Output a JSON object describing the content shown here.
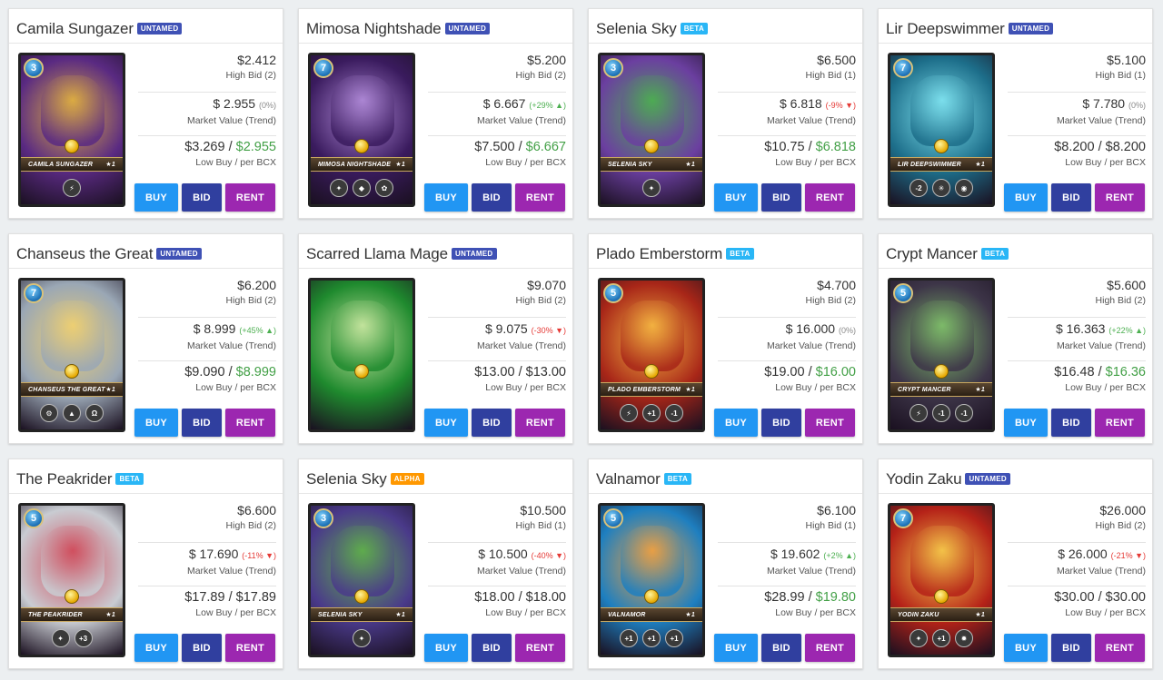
{
  "cards": [
    {
      "name": "Camila Sungazer",
      "edition": "UNTAMED",
      "edition_class": "untamed",
      "mana": "3",
      "banner": "Camila Sungazer",
      "level": "★1",
      "high_bid": "$2.412",
      "high_bid_label": "High Bid (2)",
      "market_value": "$ 2.955",
      "trend": "(0%)",
      "trend_dir": "flat",
      "market_label": "Market Value (Trend)",
      "low_buy": "$3.269",
      "per_bcx": "$2.955",
      "per_bcx_green": true,
      "low_label": "Low Buy / per BCX",
      "art_bg": "#5a2a82",
      "art_accent": "#e0b040",
      "abilities": [
        "⚡"
      ]
    },
    {
      "name": "Mimosa Nightshade",
      "edition": "UNTAMED",
      "edition_class": "untamed",
      "mana": "7",
      "banner": "Mimosa Nightshade",
      "level": "★1",
      "high_bid": "$5.200",
      "high_bid_label": "High Bid (2)",
      "market_value": "$ 6.667",
      "trend": "(+29% ▲)",
      "trend_dir": "up",
      "market_label": "Market Value (Trend)",
      "low_buy": "$7.500",
      "per_bcx": "$6.667",
      "per_bcx_green": true,
      "low_label": "Low Buy / per BCX",
      "art_bg": "#3a1b5e",
      "art_accent": "#b08ad8",
      "abilities": [
        "✦",
        "◆",
        "✿"
      ]
    },
    {
      "name": "Selenia Sky",
      "edition": "BETA",
      "edition_class": "beta",
      "mana": "3",
      "banner": "Selenia Sky",
      "level": "★1",
      "high_bid": "$6.500",
      "high_bid_label": "High Bid (1)",
      "market_value": "$ 6.818",
      "trend": "(-9% ▼)",
      "trend_dir": "down",
      "market_label": "Market Value (Trend)",
      "low_buy": "$10.75",
      "per_bcx": "$6.818",
      "per_bcx_green": true,
      "low_label": "Low Buy / per BCX",
      "art_bg": "#6b3fa0",
      "art_accent": "#4caf50",
      "abilities": [
        "✦"
      ]
    },
    {
      "name": "Lir Deepswimmer",
      "edition": "UNTAMED",
      "edition_class": "untamed",
      "mana": "7",
      "banner": "Lir Deepswimmer",
      "level": "★1",
      "high_bid": "$5.100",
      "high_bid_label": "High Bid (1)",
      "market_value": "$ 7.780",
      "trend": "(0%)",
      "trend_dir": "flat",
      "market_label": "Market Value (Trend)",
      "low_buy": "$8.200",
      "per_bcx": "$8.200",
      "per_bcx_green": false,
      "low_label": "Low Buy / per BCX",
      "art_bg": "#1d6e8a",
      "art_accent": "#7fe3f0",
      "abilities": [
        "-2",
        "✳",
        "◉"
      ]
    },
    {
      "name": "Chanseus the Great",
      "edition": "UNTAMED",
      "edition_class": "untamed",
      "mana": "7",
      "banner": "Chanseus the Great",
      "level": "★1",
      "high_bid": "$6.200",
      "high_bid_label": "High Bid (2)",
      "market_value": "$ 8.999",
      "trend": "(+45% ▲)",
      "trend_dir": "up",
      "market_label": "Market Value (Trend)",
      "low_buy": "$9.090",
      "per_bcx": "$8.999",
      "per_bcx_green": true,
      "low_label": "Low Buy / per BCX",
      "art_bg": "#9aa7b5",
      "art_accent": "#f0d070",
      "abilities": [
        "⚙",
        "▲",
        "Ω"
      ]
    },
    {
      "name": "Scarred Llama Mage",
      "edition": "UNTAMED",
      "edition_class": "untamed",
      "mana": "",
      "banner": "",
      "level": "",
      "high_bid": "$9.070",
      "high_bid_label": "High Bid (2)",
      "market_value": "$ 9.075",
      "trend": "(-30% ▼)",
      "trend_dir": "down",
      "market_label": "Market Value (Trend)",
      "low_buy": "$13.00",
      "per_bcx": "$13.00",
      "per_bcx_green": false,
      "low_label": "Low Buy / per BCX",
      "art_bg": "#1f8a2e",
      "art_accent": "#c8e6a0",
      "abilities": []
    },
    {
      "name": "Plado Emberstorm",
      "edition": "BETA",
      "edition_class": "beta",
      "mana": "5",
      "banner": "Plado Emberstorm",
      "level": "★1",
      "high_bid": "$4.700",
      "high_bid_label": "High Bid (2)",
      "market_value": "$ 16.000",
      "trend": "(0%)",
      "trend_dir": "flat",
      "market_label": "Market Value (Trend)",
      "low_buy": "$19.00",
      "per_bcx": "$16.00",
      "per_bcx_green": true,
      "low_label": "Low Buy / per BCX",
      "art_bg": "#a82618",
      "art_accent": "#f5b642",
      "abilities": [
        "⚡",
        "+1",
        "-1"
      ]
    },
    {
      "name": "Crypt Mancer",
      "edition": "BETA",
      "edition_class": "beta",
      "mana": "5",
      "banner": "Crypt Mancer",
      "level": "★1",
      "high_bid": "$5.600",
      "high_bid_label": "High Bid (2)",
      "market_value": "$ 16.363",
      "trend": "(+22% ▲)",
      "trend_dir": "up",
      "market_label": "Market Value (Trend)",
      "low_buy": "$16.48",
      "per_bcx": "$16.36",
      "per_bcx_green": true,
      "low_label": "Low Buy / per BCX",
      "art_bg": "#3d3548",
      "art_accent": "#7fbf6a",
      "abilities": [
        "⚡",
        "-1",
        "-1"
      ]
    },
    {
      "name": "The Peakrider",
      "edition": "BETA",
      "edition_class": "beta",
      "mana": "5",
      "banner": "The Peakrider",
      "level": "★1",
      "high_bid": "$6.600",
      "high_bid_label": "High Bid (2)",
      "market_value": "$ 17.690",
      "trend": "(-11% ▼)",
      "trend_dir": "down",
      "market_label": "Market Value (Trend)",
      "low_buy": "$17.89",
      "per_bcx": "$17.89",
      "per_bcx_green": false,
      "low_label": "Low Buy / per BCX",
      "art_bg": "#c9ccd2",
      "art_accent": "#d04a5a",
      "abilities": [
        "✦",
        "+3"
      ]
    },
    {
      "name": "Selenia Sky",
      "edition": "ALPHA",
      "edition_class": "alpha",
      "mana": "3",
      "banner": "Selenia Sky",
      "level": "★1",
      "high_bid": "$10.500",
      "high_bid_label": "High Bid (1)",
      "market_value": "$ 10.500",
      "trend": "(-40% ▼)",
      "trend_dir": "down",
      "market_label": "Market Value (Trend)",
      "low_buy": "$18.00",
      "per_bcx": "$18.00",
      "per_bcx_green": false,
      "low_label": "Low Buy / per BCX",
      "art_bg": "#4a3a8a",
      "art_accent": "#5fb04a",
      "abilities": [
        "✦"
      ]
    },
    {
      "name": "Valnamor",
      "edition": "BETA",
      "edition_class": "beta",
      "mana": "5",
      "banner": "Valnamor",
      "level": "★1",
      "high_bid": "$6.100",
      "high_bid_label": "High Bid (1)",
      "market_value": "$ 19.602",
      "trend": "(+2% ▲)",
      "trend_dir": "up",
      "market_label": "Market Value (Trend)",
      "low_buy": "$28.99",
      "per_bcx": "$19.80",
      "per_bcx_green": true,
      "low_label": "Low Buy / per BCX",
      "art_bg": "#1e7fc0",
      "art_accent": "#f0a040",
      "abilities": [
        "+1",
        "+1",
        "+1"
      ]
    },
    {
      "name": "Yodin Zaku",
      "edition": "UNTAMED",
      "edition_class": "untamed",
      "mana": "7",
      "banner": "Yodin Zaku",
      "level": "★1",
      "high_bid": "$26.000",
      "high_bid_label": "High Bid (2)",
      "market_value": "$ 26.000",
      "trend": "(-21% ▼)",
      "trend_dir": "down",
      "market_label": "Market Value (Trend)",
      "low_buy": "$30.00",
      "per_bcx": "$30.00",
      "per_bcx_green": false,
      "low_label": "Low Buy / per BCX",
      "art_bg": "#b52218",
      "art_accent": "#f5c84a",
      "abilities": [
        "✦",
        "+1",
        "✹"
      ]
    }
  ],
  "buttons": {
    "buy": "BUY",
    "bid": "BID",
    "rent": "RENT"
  },
  "colors": {
    "buy": "#2196f3",
    "bid": "#303f9f",
    "rent": "#9c27b0",
    "untamed": "#3f51b5",
    "beta": "#29b6f6",
    "alpha": "#ff9800",
    "up": "#4caf50",
    "down": "#e53935"
  }
}
